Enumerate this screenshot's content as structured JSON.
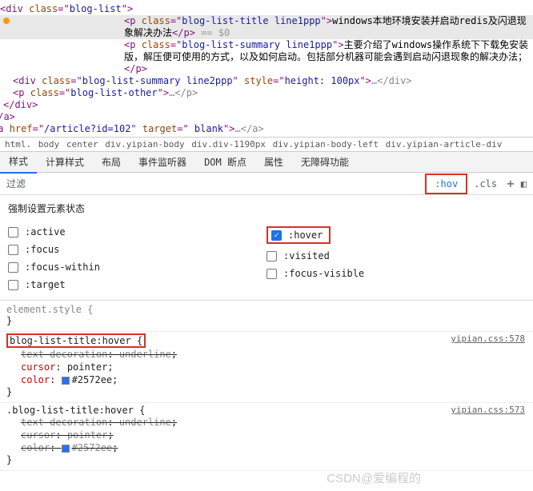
{
  "dom": {
    "line1_open": "<div ",
    "line1_cls": "class",
    "line1_eq": "=\"",
    "line1_val": "blog-list",
    "line1_close": "\">",
    "line2_open": "<p ",
    "line2_cls": "class",
    "line2_val": "blog-list-title line1ppp",
    "line2_close": "\">",
    "line2_text": "windows本地环境安装并启动redis及闪退现象解决办法",
    "line2_end": "</p>",
    "line2_eq": " == $0",
    "line3_open": "<p ",
    "line3_val": "blog-list-summary line1ppp",
    "line3_text": "主要介绍了windows操作系统下下载免安装版，解压便可使用的方式，以及如何启动。包括部分机器可能会遇到启动闪退现象的解决办法；",
    "line3_end": "</p>",
    "line4_open": "<div ",
    "line4_val": "blog-list-summary line2ppp",
    "line4_style_name": "style",
    "line4_style_val": "height: 100px",
    "line4_end": "…</div>",
    "line5_open": "<p ",
    "line5_val": "blog-list-other",
    "line5_end": "…</p>",
    "line6": "</div>",
    "line7": "</a>",
    "line8_open": "<a ",
    "line8_href": "href",
    "line8_href_val": "/article?id=102",
    "line8_target": "target",
    "line8_target_val": " blank",
    "line8_end": "…</a>"
  },
  "breadcrumb": {
    "b1": "html.",
    "b2": "body",
    "b3": "center",
    "b4": "div.yipian-body",
    "b5": "div.div-1190px",
    "b6": "div.yipian-body-left",
    "b7": "div.yipian-article-div"
  },
  "tabs": {
    "t1": "样式",
    "t2": "计算样式",
    "t3": "布局",
    "t4": "事件监听器",
    "t5": "DOM 断点",
    "t6": "属性",
    "t7": "无障碍功能"
  },
  "filter": {
    "label": "过滤",
    "hov": ":hov",
    "cls": ".cls"
  },
  "force_state": {
    "title": "强制设置元素状态",
    "s1": ":active",
    "s2": ":focus",
    "s3": ":focus-within",
    "s4": ":target",
    "s5": ":hover",
    "s6": ":visited",
    "s7": ":focus-visible"
  },
  "styles": {
    "elem_style": "element.style {",
    "rule1_sel": "blog-list-title:hover {",
    "rule1_src": "yipian.css:578",
    "rule1_p1n": "text-decoration",
    "rule1_p1v": "underline",
    "rule1_p2n": "cursor",
    "rule1_p2v": "pointer",
    "rule1_p3n": "color",
    "rule1_p3v": "#2572ee",
    "rule2_sel": ".blog-list-title:hover {",
    "rule2_src": "yipian.css:573",
    "rule2_p1n": "text-decoration",
    "rule2_p1v": "underline",
    "rule2_p2n": "cursor",
    "rule2_p2v": "pointer",
    "rule2_p3n": "color",
    "rule2_p3v": "#2572ee",
    "close_brace": "}"
  },
  "watermark": "CSDN@爱编程的"
}
